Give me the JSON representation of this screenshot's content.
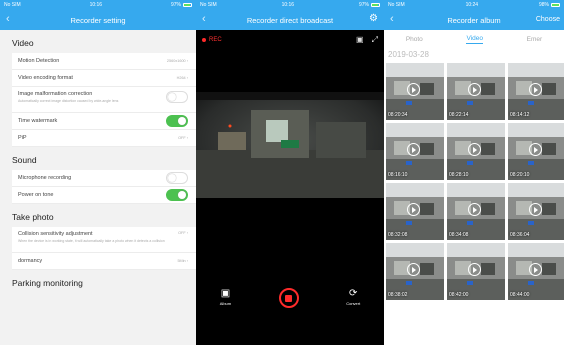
{
  "settings": {
    "status": {
      "carrier": "No SIM",
      "time": "10:16",
      "battery": "97%"
    },
    "title": "Recorder setting",
    "sections": {
      "video": "Video",
      "sound": "Sound",
      "photo": "Take photo",
      "parking": "Parking monitoring"
    },
    "rows": {
      "motion_detection": {
        "label": "Motion Detection",
        "value": "2560x1600"
      },
      "encoding": {
        "label": "Video encoding format",
        "value": "H264"
      },
      "malformation": {
        "label": "Image malformation correction",
        "sub": "Automatically correct image distortion caused by wide-angle lens",
        "on": false
      },
      "watermark": {
        "label": "Time watermark",
        "on": true
      },
      "pip": {
        "label": "PiP",
        "value": "OFF"
      },
      "microphone": {
        "label": "Microphone recording",
        "on": false
      },
      "power_tone": {
        "label": "Power on tone",
        "on": true
      },
      "collision": {
        "label": "Collision sensitivity adjustment",
        "value": "OFF",
        "sub": "When the device is in working state, it will automatically take a photo when it detects a collision"
      },
      "dormancy": {
        "label": "dormancy",
        "value": "5Min"
      }
    }
  },
  "broadcast": {
    "status": {
      "carrier": "No SIM",
      "time": "10:16",
      "battery": "97%"
    },
    "title": "Recorder direct broadcast",
    "rec_label": "REC",
    "album_label": "Album",
    "convert_label": "Convert"
  },
  "album": {
    "status": {
      "carrier": "No SIM",
      "time": "10:24",
      "battery": "98%"
    },
    "title": "Recorder album",
    "choose": "Choose",
    "tabs": [
      "Photo",
      "Video",
      "Emer"
    ],
    "active_tab": "Video",
    "date": "2019-03-28",
    "thumbs": [
      "08:20:34",
      "08:22:14",
      "08:14:12",
      "08:16:10",
      "08:28:10",
      "08:20:10",
      "08:32:08",
      "08:34:08",
      "08:36:04",
      "08:38:02",
      "08:42:00",
      "08:44:00"
    ]
  },
  "colors": {
    "accent": "#36a9ee",
    "toggle_on": "#4cc150",
    "rec": "#ff2b2b"
  }
}
